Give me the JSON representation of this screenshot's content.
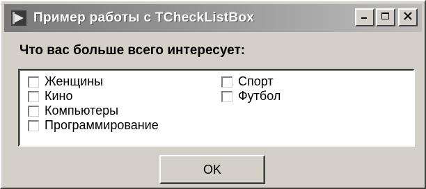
{
  "window": {
    "title": "Пример работы с TCheckListBox"
  },
  "prompt": "Что вас больше всего интересует:",
  "checklist": {
    "column1": [
      {
        "label": "Женщины",
        "checked": false
      },
      {
        "label": "Кино",
        "checked": false
      },
      {
        "label": "Компьютеры",
        "checked": false
      },
      {
        "label": "Программирование",
        "checked": false
      }
    ],
    "column2": [
      {
        "label": "Спорт",
        "checked": false
      },
      {
        "label": "Футбол",
        "checked": false
      }
    ]
  },
  "buttons": {
    "ok_label": "OK"
  },
  "icons": {
    "app": "app-icon",
    "minimize": "minimize-icon",
    "maximize": "maximize-icon",
    "close": "close-icon"
  },
  "colors": {
    "face": "#d4d0c8",
    "titlebar_inactive": "#9c9c9c",
    "list_background": "#ffffff"
  }
}
